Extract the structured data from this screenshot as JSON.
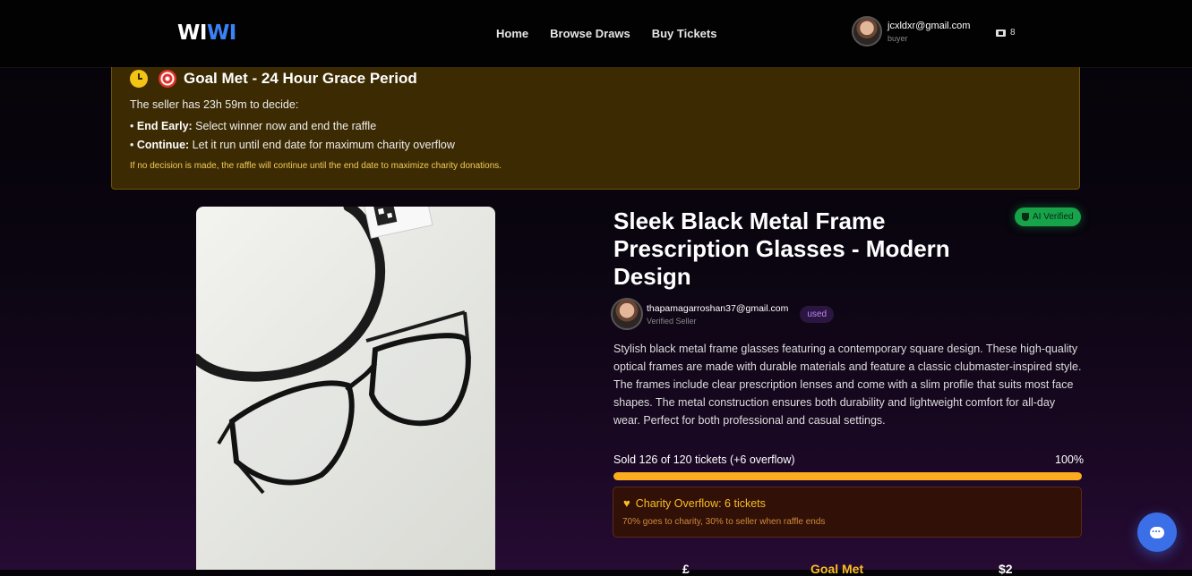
{
  "nav": {
    "logo_part1": "WI",
    "logo_part2": "WI",
    "links": [
      "Home",
      "Browse Draws",
      "Buy Tickets"
    ],
    "user_email": "jcxldxr@gmail.com",
    "user_role": "buyer",
    "ticket_count": "8"
  },
  "goal_banner": {
    "title": "Goal Met - 24 Hour Grace Period",
    "intro": "The seller has 23h 59m to decide:",
    "option1_label": "End Early:",
    "option1_text": " Select winner now and end the raffle",
    "option2_label": "Continue:",
    "option2_text": " Let it run until end date for maximum charity overflow",
    "note": "If no decision is made, the raffle will continue until the end date to maximize charity donations."
  },
  "listing": {
    "title": "Sleek Black Metal Frame Prescription Glasses - Modern Design",
    "ai_badge": "AI Verified",
    "seller_email": "thapamagarroshan37@gmail.com",
    "seller_role": "Verified Seller",
    "condition": "used",
    "description": "Stylish black metal frame glasses featuring a contemporary square design. These high-quality optical frames are made with durable materials and feature a classic clubmaster-inspired style. The frames include clear prescription lenses and come with a slim profile that suits most face shapes. The metal construction ensures both durability and lightweight comfort for all-day wear. Perfect for both professional and casual settings.",
    "sold_text": "Sold 126 of 120 tickets (+6 overflow)",
    "percent_text": "100%",
    "progress": 1.0,
    "charity_title": "Charity Overflow: 6 tickets",
    "charity_sub": "70% goes to charity, 30% to seller when raffle ends"
  },
  "bottom_stats": [
    "£",
    "Goal Met",
    "$2"
  ],
  "colors": {
    "accent_blue": "#3b82f6",
    "goal_bg": "#3c2b02",
    "progress": "#fbab1f",
    "ai_green": "#16a34a"
  }
}
